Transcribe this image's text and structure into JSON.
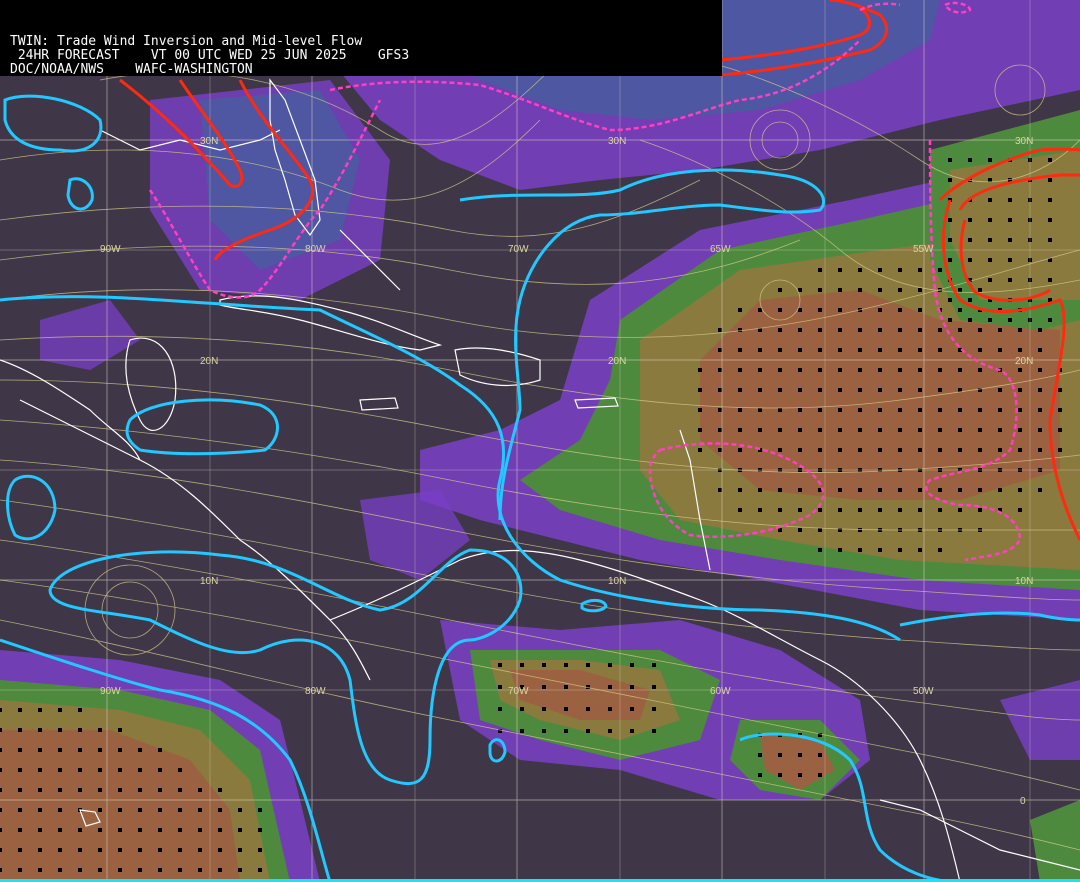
{
  "header": {
    "line1": "TWIN: Trade Wind Inversion and Mid-level Flow",
    "line2": " 24HR FORECAST    VT 00 UTC WED 25 JUN 2025    GFS3",
    "line3": "DOC/NOAA/NWS    WAFC-WASHINGTON"
  },
  "graticule": {
    "lon_labels_top": [
      "90W",
      "80W",
      "70W",
      "65W",
      "55W"
    ],
    "lon_labels_bottom": [
      "90W",
      "80W",
      "70W",
      "60W",
      "50W"
    ],
    "lat_labels": [
      "30N",
      "20N",
      "10N",
      "0"
    ],
    "extra_labels": [
      "30N",
      "20N",
      "10N",
      "20N",
      "10N",
      "30N"
    ]
  },
  "colors": {
    "background": "#3f3747",
    "purple": "#7a3fc8",
    "blue": "#4a5aa0",
    "green": "#4e8a3e",
    "olive": "#8a7a3e",
    "brown": "#9a6240",
    "cyan_contour": "#22c8ff",
    "red_contour": "#ff2a10",
    "magenta_dashed": "#ff40c0",
    "streamline": "#d8cf8a",
    "coastline": "#ffffff"
  }
}
